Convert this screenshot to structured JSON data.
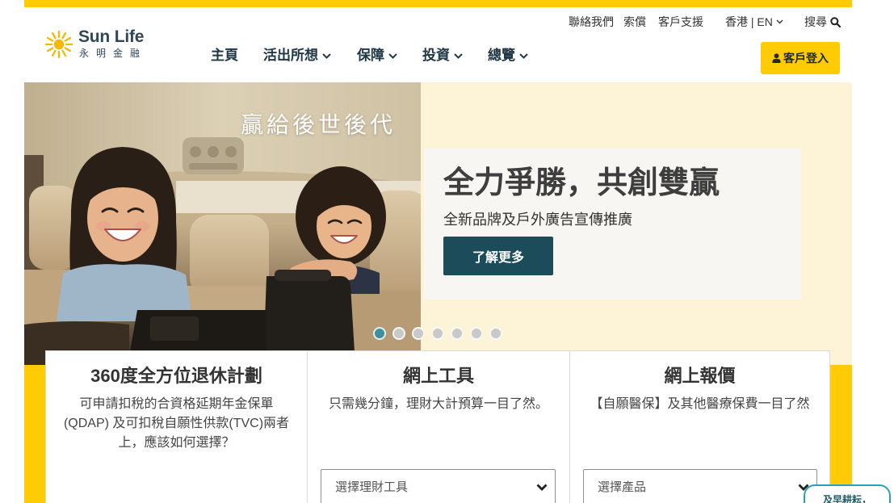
{
  "brand": {
    "wordmark": "Sun Life",
    "chinese_name": "永明金融",
    "logo_icon": "sun-icon"
  },
  "utility_nav": {
    "contact": "聯絡我們",
    "claims": "索償",
    "support": "客戶支援",
    "locale": "香港 | EN",
    "search": "搜尋"
  },
  "main_nav": [
    {
      "label": "主頁",
      "dropdown": false
    },
    {
      "label": "活出所想",
      "dropdown": true
    },
    {
      "label": "保障",
      "dropdown": true
    },
    {
      "label": "投資",
      "dropdown": true
    },
    {
      "label": "總覽",
      "dropdown": true
    }
  ],
  "login": {
    "label": "客戶登入",
    "icon": "user-icon"
  },
  "hero": {
    "image_caption": "贏給後世後代",
    "heading": "全力爭勝，共創雙贏",
    "subheading": "全新品牌及戶外廣告宣傳推廣",
    "cta_label": "了解更多",
    "slide_count": 7,
    "active_slide": 1
  },
  "cards": [
    {
      "title": "360度全方位退休計劃",
      "description": "可申請扣稅的合資格延期年金保單(QDAP) 及可扣稅自願性供款(TVC)兩者上，應該如何選擇？"
    },
    {
      "title": "網上工具",
      "description": "只需幾分鐘，理財大計預算一目了然。",
      "select_value": "選擇理財工具"
    },
    {
      "title": "網上報價",
      "description": "【自願醫保】及其他醫療保費一目了然",
      "select_value": "選擇產品"
    }
  ],
  "floating_widget": {
    "label": "及早耕耘，"
  },
  "colors": {
    "brand_yellow": "#FFCB05",
    "hero_cream": "#FDF3D6",
    "cta_teal": "#1C4C5A",
    "active_dot": "#3E8E9E",
    "inactive_dot": "#C9C9C9",
    "widget_border": "#2AA3B1"
  }
}
